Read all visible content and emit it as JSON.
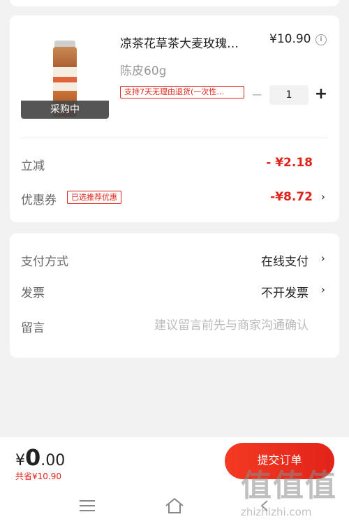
{
  "product": {
    "title": "凉茶花草茶大麦玫瑰…",
    "price": "¥10.90",
    "info_icon": "i",
    "variant": "陈皮60g",
    "return_policy": "支持7天无理由退货(一次性…",
    "status_tag": "采购中",
    "quantity": "1",
    "minus_symbol": "−",
    "plus_symbol": "+"
  },
  "discounts": {
    "instant_label": "立减",
    "instant_value": "- ¥2.18",
    "coupon_label": "优惠券",
    "coupon_tag": "已选推荐优惠",
    "coupon_value": "-¥8.72"
  },
  "order_info": {
    "payment_label": "支付方式",
    "payment_value": "在线支付",
    "invoice_label": "发票",
    "invoice_value": "不开发票",
    "note_label": "留言",
    "note_placeholder": "建议留言前先与商家沟通确认"
  },
  "chevron": "›",
  "footer": {
    "currency": "¥",
    "total_int": "0",
    "total_dec": ".00",
    "saved": "共省¥10.90",
    "submit_label": "提交订单"
  },
  "watermark": {
    "big": "值值值",
    "small": "zhizhizhi.com"
  },
  "colors": {
    "accent": "#e2231a",
    "background": "#f2f2f2"
  },
  "icons": [
    "info-icon",
    "chevron-right-icon",
    "menu-icon",
    "home-icon",
    "back-icon"
  ]
}
